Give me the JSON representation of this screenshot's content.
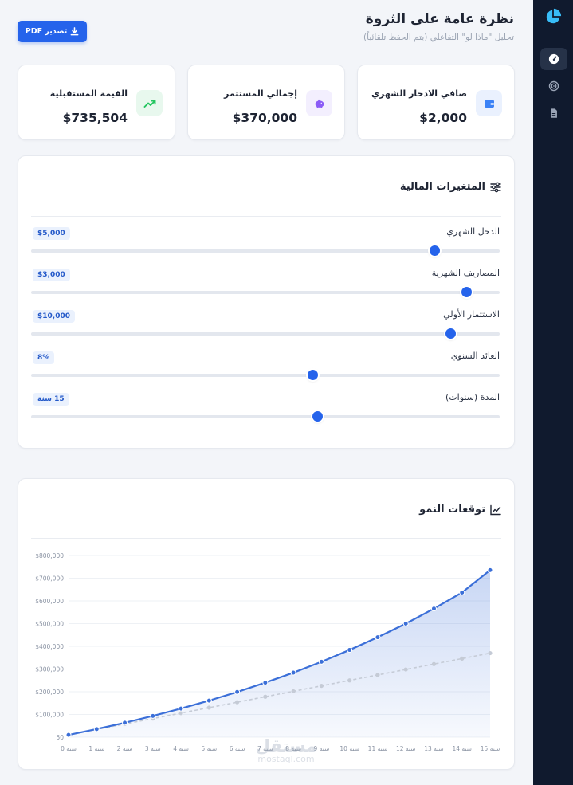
{
  "header": {
    "title": "نظرة عامة على الثروة",
    "subtitle": "تحليل \"ماذا لو\" التفاعلي (يتم الحفظ تلقائياً)",
    "export_label": "تصدير PDF"
  },
  "sidebar": {
    "items": [
      {
        "icon": "gauge-icon"
      },
      {
        "icon": "target-icon"
      },
      {
        "icon": "document-icon"
      }
    ]
  },
  "stats": [
    {
      "label": "صافي الادخار الشهري",
      "value": "$2,000",
      "icon": "wallet-icon",
      "color": "#3b82f6"
    },
    {
      "label": "إجمالي المستثمر",
      "value": "$370,000",
      "icon": "piggy-bank-icon",
      "color": "#8b5cf6"
    },
    {
      "label": "القيمة المستقبلية",
      "value": "$735,504",
      "icon": "trending-up-icon",
      "color": "#22c55e"
    }
  ],
  "variables": {
    "title": "المتغيرات المالية",
    "sliders": [
      {
        "label": "الدخل الشهري",
        "value": "$5,000",
        "level": 0.86
      },
      {
        "label": "المصاريف الشهرية",
        "value": "$3,000",
        "level": 0.928
      },
      {
        "label": "الاستثمار الأولي",
        "value": "$10,000",
        "level": 0.894
      },
      {
        "label": "العائد السنوي",
        "value": "8%",
        "level": 0.6
      },
      {
        "label": "المدة (سنوات)",
        "value": "15 سنة",
        "level": 0.61
      }
    ]
  },
  "growth": {
    "title": "توقعات النمو"
  },
  "chart_data": {
    "type": "line",
    "x": [
      "سنة 0",
      "سنة 1",
      "سنة 2",
      "سنة 3",
      "سنة 4",
      "سنة 5",
      "سنة 6",
      "سنة 7",
      "سنة 8",
      "سنة 9",
      "سنة 10",
      "سنة 11",
      "سنة 12",
      "سنة 13",
      "سنة 14",
      "سنة 15"
    ],
    "y_ticks": [
      "50",
      "$100,000",
      "$200,000",
      "$300,000",
      "$400,000",
      "$500,000",
      "$600,000",
      "$700,000",
      "$800,000"
    ],
    "ylim": [
      0,
      800000
    ],
    "series": [
      {
        "values": [
          10000,
          35700,
          63500,
          93500,
          126000,
          161000,
          199000,
          240000,
          284000,
          332000,
          384000,
          440000,
          500000,
          566000,
          637000,
          735504
        ],
        "color": "#3b6fd8"
      },
      {
        "values": [
          10000,
          34000,
          58000,
          82000,
          106000,
          130000,
          154000,
          178000,
          202000,
          226000,
          250000,
          274000,
          298000,
          322000,
          346000,
          370000
        ],
        "color": "#c5cbd6"
      }
    ],
    "grid": true
  }
}
